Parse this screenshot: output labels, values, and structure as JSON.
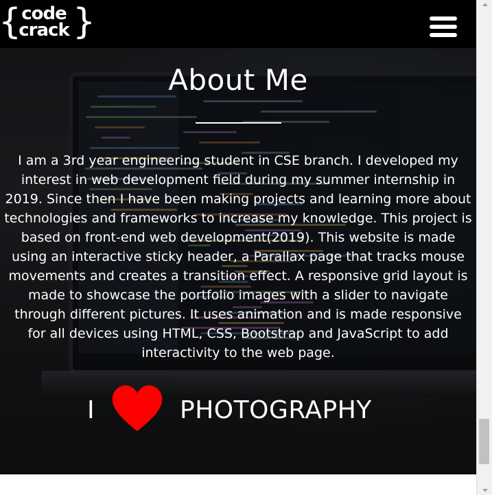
{
  "header": {
    "logo_line1": "code",
    "logo_line2": "crack",
    "logo_brace_left": "{",
    "logo_brace_right": "}",
    "menu_icon": "hamburger-menu-icon"
  },
  "about": {
    "title": "About Me",
    "text": "I am a 3rd year engineering student in CSE branch. I developed my interest in web development field during my summer internship in 2019. Since then I have been making projects and learning more about technologies and frameworks to increase my knowledge. This project is based on front-end web development(2019). This website is made using an interactive sticky header, a Parallax page that tracks mouse movements and creates a transition effect. A responsive grid layout is made to showcase the portfolio images with a slider to navigate through different pictures. It uses animation and is made responsive for all devices using HTML, CSS, Bootstrap and JavaScript to add interactivity to the web page."
  },
  "photography": {
    "prefix": "I",
    "heart_icon": "heart-icon",
    "word": "PHOTOGRAPHY"
  },
  "colors": {
    "header_bg": "#000000",
    "text": "#ffffff",
    "heart": "#ff0000"
  }
}
